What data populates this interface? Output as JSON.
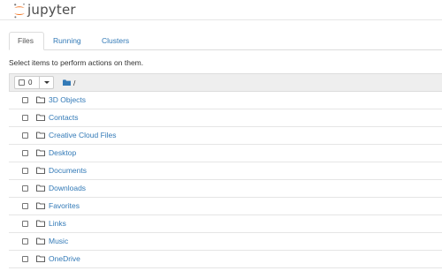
{
  "app": {
    "logo_text": "jupyter"
  },
  "tabs": [
    {
      "label": "Files",
      "active": true
    },
    {
      "label": "Running",
      "active": false
    },
    {
      "label": "Clusters",
      "active": false
    }
  ],
  "instructions": "Select items to perform actions on them.",
  "list_header": {
    "selected_count": "0",
    "path": "/"
  },
  "files": [
    {
      "name": "3D Objects",
      "type": "folder"
    },
    {
      "name": "Contacts",
      "type": "folder"
    },
    {
      "name": "Creative Cloud Files",
      "type": "folder"
    },
    {
      "name": "Desktop",
      "type": "folder"
    },
    {
      "name": "Documents",
      "type": "folder"
    },
    {
      "name": "Downloads",
      "type": "folder"
    },
    {
      "name": "Favorites",
      "type": "folder"
    },
    {
      "name": "Links",
      "type": "folder"
    },
    {
      "name": "Music",
      "type": "folder"
    },
    {
      "name": "OneDrive",
      "type": "folder"
    }
  ],
  "colors": {
    "link": "#337ab7",
    "logo_orange": "#f37726",
    "header_bg": "#eeeeee"
  }
}
